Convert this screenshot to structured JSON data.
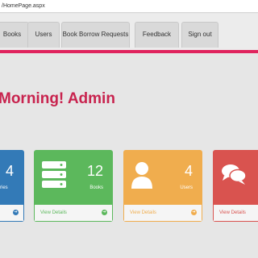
{
  "browser": {
    "url": "/HomePage.aspx"
  },
  "nav": {
    "tabs": [
      {
        "label": "Books"
      },
      {
        "label": "Users"
      },
      {
        "label": "Book Borrow Requests"
      },
      {
        "label": "Feedback"
      },
      {
        "label": "Sign out"
      }
    ]
  },
  "greeting": "Morning! Admin",
  "cards": [
    {
      "count": "4",
      "label": "egories",
      "link": "",
      "color": "#337ab7",
      "icon": "category-icon"
    },
    {
      "count": "12",
      "label": "Books",
      "link": "View Details",
      "color": "#5cb85c",
      "icon": "server-stack-icon"
    },
    {
      "count": "4",
      "label": "Users",
      "link": "View Details",
      "color": "#f0ad4e",
      "icon": "user-icon"
    },
    {
      "count": "",
      "label": "",
      "link": "View Details",
      "color": "#d9534f",
      "icon": "chat-bubbles-icon"
    }
  ],
  "arrow_glyph": "➔"
}
